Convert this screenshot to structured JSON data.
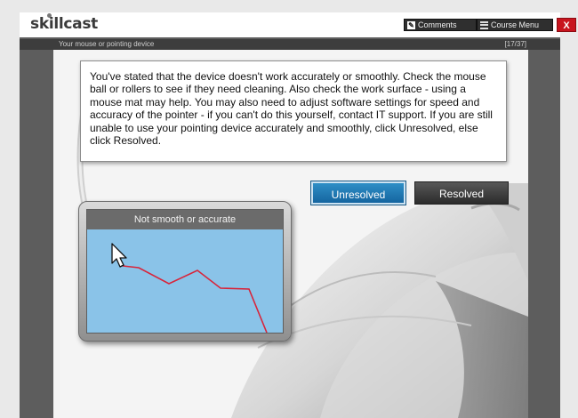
{
  "header": {
    "logo": "skillcast",
    "comments_label": "Comments",
    "course_menu_label": "Course Menu",
    "close_label": "X"
  },
  "course": {
    "page_title": "Your mouse or pointing device",
    "page_progress": "[17/37]"
  },
  "content": {
    "instructions": "You've stated that the device doesn't work accurately or smoothly. Check the mouse ball or rollers to see if they need cleaning. Also check the work surface - using a mouse mat may help. You may also need to adjust software settings for speed and accuracy of the pointer - if you can't do this yourself, contact IT support. If you are still unable to use your pointing device accurately and smoothly, click Unresolved, else click Resolved.",
    "unresolved_label": "Unresolved",
    "resolved_label": "Resolved",
    "panel_title": "Not smooth or accurate"
  },
  "colors": {
    "accent_blue": "#1f78b4",
    "close_red": "#c8141e",
    "panel_sky": "#8ac3e8",
    "trail_red": "#d8243a"
  },
  "icons": [
    "comments-icon",
    "menu-icon",
    "close-icon",
    "cursor-icon"
  ]
}
